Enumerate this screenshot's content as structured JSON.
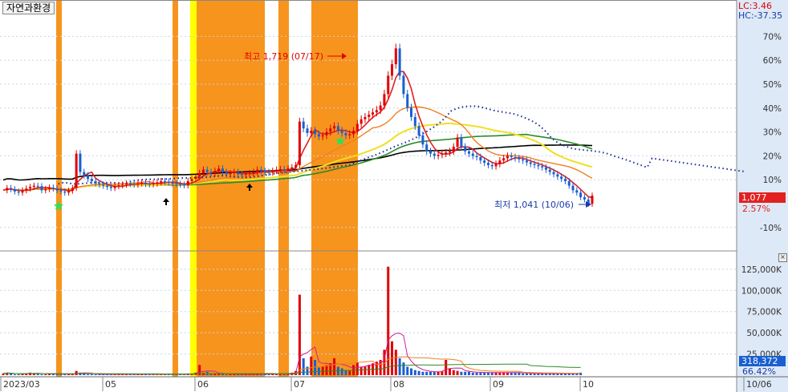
{
  "stock_name": "자연과환경",
  "lc_label": "LC:3.46",
  "hc_label": "HC:-37.35",
  "current_price": "1,077",
  "current_pct": "2.57%",
  "current_volume": "318,372",
  "volume_pct": "66.42%",
  "high_annotation": "최고 1,719 (07/17)",
  "low_annotation": "최저 1,041 (10/06)",
  "pct_ticks": [
    "70%",
    "60%",
    "50%",
    "40%",
    "30%",
    "20%",
    "10%",
    "-10%"
  ],
  "volume_ticks": [
    "125,000K",
    "100,000K",
    "75,000K",
    "50,000K",
    "25,000K"
  ],
  "date_ticks": [
    "2023/03",
    "05",
    "06",
    "07",
    "08",
    "09",
    "10",
    "10/06"
  ],
  "colors": {
    "candle_up": "#e00000",
    "candle_down": "#1a5fd1",
    "highlight_orange": "#f7941d",
    "highlight_yellow": "#ffff00",
    "ma_short": "#e02020",
    "ma_mid": "#f08020",
    "ma_long": "#2a8a2a",
    "ma_yellow": "#f0e020",
    "ma_black": "#000000",
    "dotted": "#1a2a9a"
  },
  "chart_data": {
    "type": "candlestick",
    "title": "자연과환경",
    "high": {
      "price": 1719,
      "date": "07/17"
    },
    "low": {
      "price": 1041,
      "date": "10/06"
    },
    "last_price": 1077,
    "last_volume": 318372,
    "pct_axis": [
      70,
      60,
      50,
      40,
      30,
      20,
      10,
      -10
    ],
    "volume_axis_k": [
      125000,
      100000,
      75000,
      50000,
      25000
    ],
    "x_ticks": [
      "2023/03",
      "05",
      "06",
      "07",
      "08",
      "09",
      "10",
      "10/06"
    ],
    "price_series": [
      1100,
      1110,
      1105,
      1095,
      1090,
      1100,
      1108,
      1115,
      1120,
      1118,
      1100,
      1105,
      1112,
      1108,
      1100,
      1095,
      1090,
      1098,
      1110,
      1260,
      1180,
      1165,
      1150,
      1140,
      1130,
      1125,
      1120,
      1115,
      1110,
      1118,
      1122,
      1125,
      1130,
      1128,
      1125,
      1130,
      1133,
      1128,
      1126,
      1130,
      1135,
      1140,
      1138,
      1134,
      1130,
      1128,
      1125,
      1122,
      1140,
      1150,
      1160,
      1175,
      1190,
      1180,
      1175,
      1185,
      1195,
      1180,
      1170,
      1175,
      1180,
      1170,
      1168,
      1172,
      1175,
      1180,
      1190,
      1185,
      1180,
      1178,
      1185,
      1190,
      1192,
      1188,
      1195,
      1200,
      1210,
      1400,
      1370,
      1350,
      1360,
      1345,
      1335,
      1340,
      1355,
      1370,
      1380,
      1360,
      1350,
      1340,
      1345,
      1360,
      1390,
      1410,
      1420,
      1430,
      1440,
      1450,
      1470,
      1520,
      1600,
      1650,
      1719,
      1600,
      1520,
      1460,
      1420,
      1380,
      1340,
      1300,
      1270,
      1260,
      1250,
      1255,
      1260,
      1265,
      1270,
      1290,
      1330,
      1290,
      1270,
      1260,
      1250,
      1245,
      1230,
      1220,
      1210,
      1205,
      1215,
      1230,
      1240,
      1250,
      1245,
      1240,
      1235,
      1230,
      1222,
      1215,
      1210,
      1205,
      1200,
      1190,
      1180,
      1170,
      1160,
      1150,
      1140,
      1120,
      1100,
      1090,
      1070,
      1060,
      1041,
      1077
    ],
    "volume_k": [
      2,
      3,
      2,
      1,
      1,
      2,
      2,
      3,
      2,
      2,
      1,
      1,
      2,
      2,
      1,
      1,
      1,
      1,
      2,
      5,
      3,
      2,
      1,
      1,
      1,
      1,
      1,
      1,
      1,
      1,
      1,
      1,
      1,
      1,
      1,
      1,
      1,
      1,
      1,
      1,
      1,
      1,
      1,
      1,
      1,
      1,
      1,
      1,
      2,
      2,
      3,
      12,
      3,
      4,
      2,
      2,
      2,
      2,
      1,
      1,
      1,
      1,
      1,
      1,
      1,
      1,
      2,
      1,
      1,
      1,
      2,
      2,
      2,
      2,
      2,
      3,
      5,
      95,
      20,
      10,
      22,
      18,
      9,
      10,
      12,
      14,
      20,
      10,
      8,
      6,
      5,
      12,
      15,
      10,
      10,
      12,
      14,
      16,
      18,
      30,
      128,
      40,
      30,
      20,
      15,
      10,
      8,
      6,
      5,
      4,
      4,
      4,
      4,
      4,
      5,
      18,
      8,
      6,
      5,
      4,
      4,
      4,
      3,
      3,
      3,
      3,
      3,
      3,
      3,
      3,
      3,
      3,
      3,
      3,
      3,
      2,
      2,
      2,
      2,
      2,
      2,
      2,
      2,
      2,
      2,
      2,
      2,
      2,
      2,
      2,
      3
    ]
  }
}
